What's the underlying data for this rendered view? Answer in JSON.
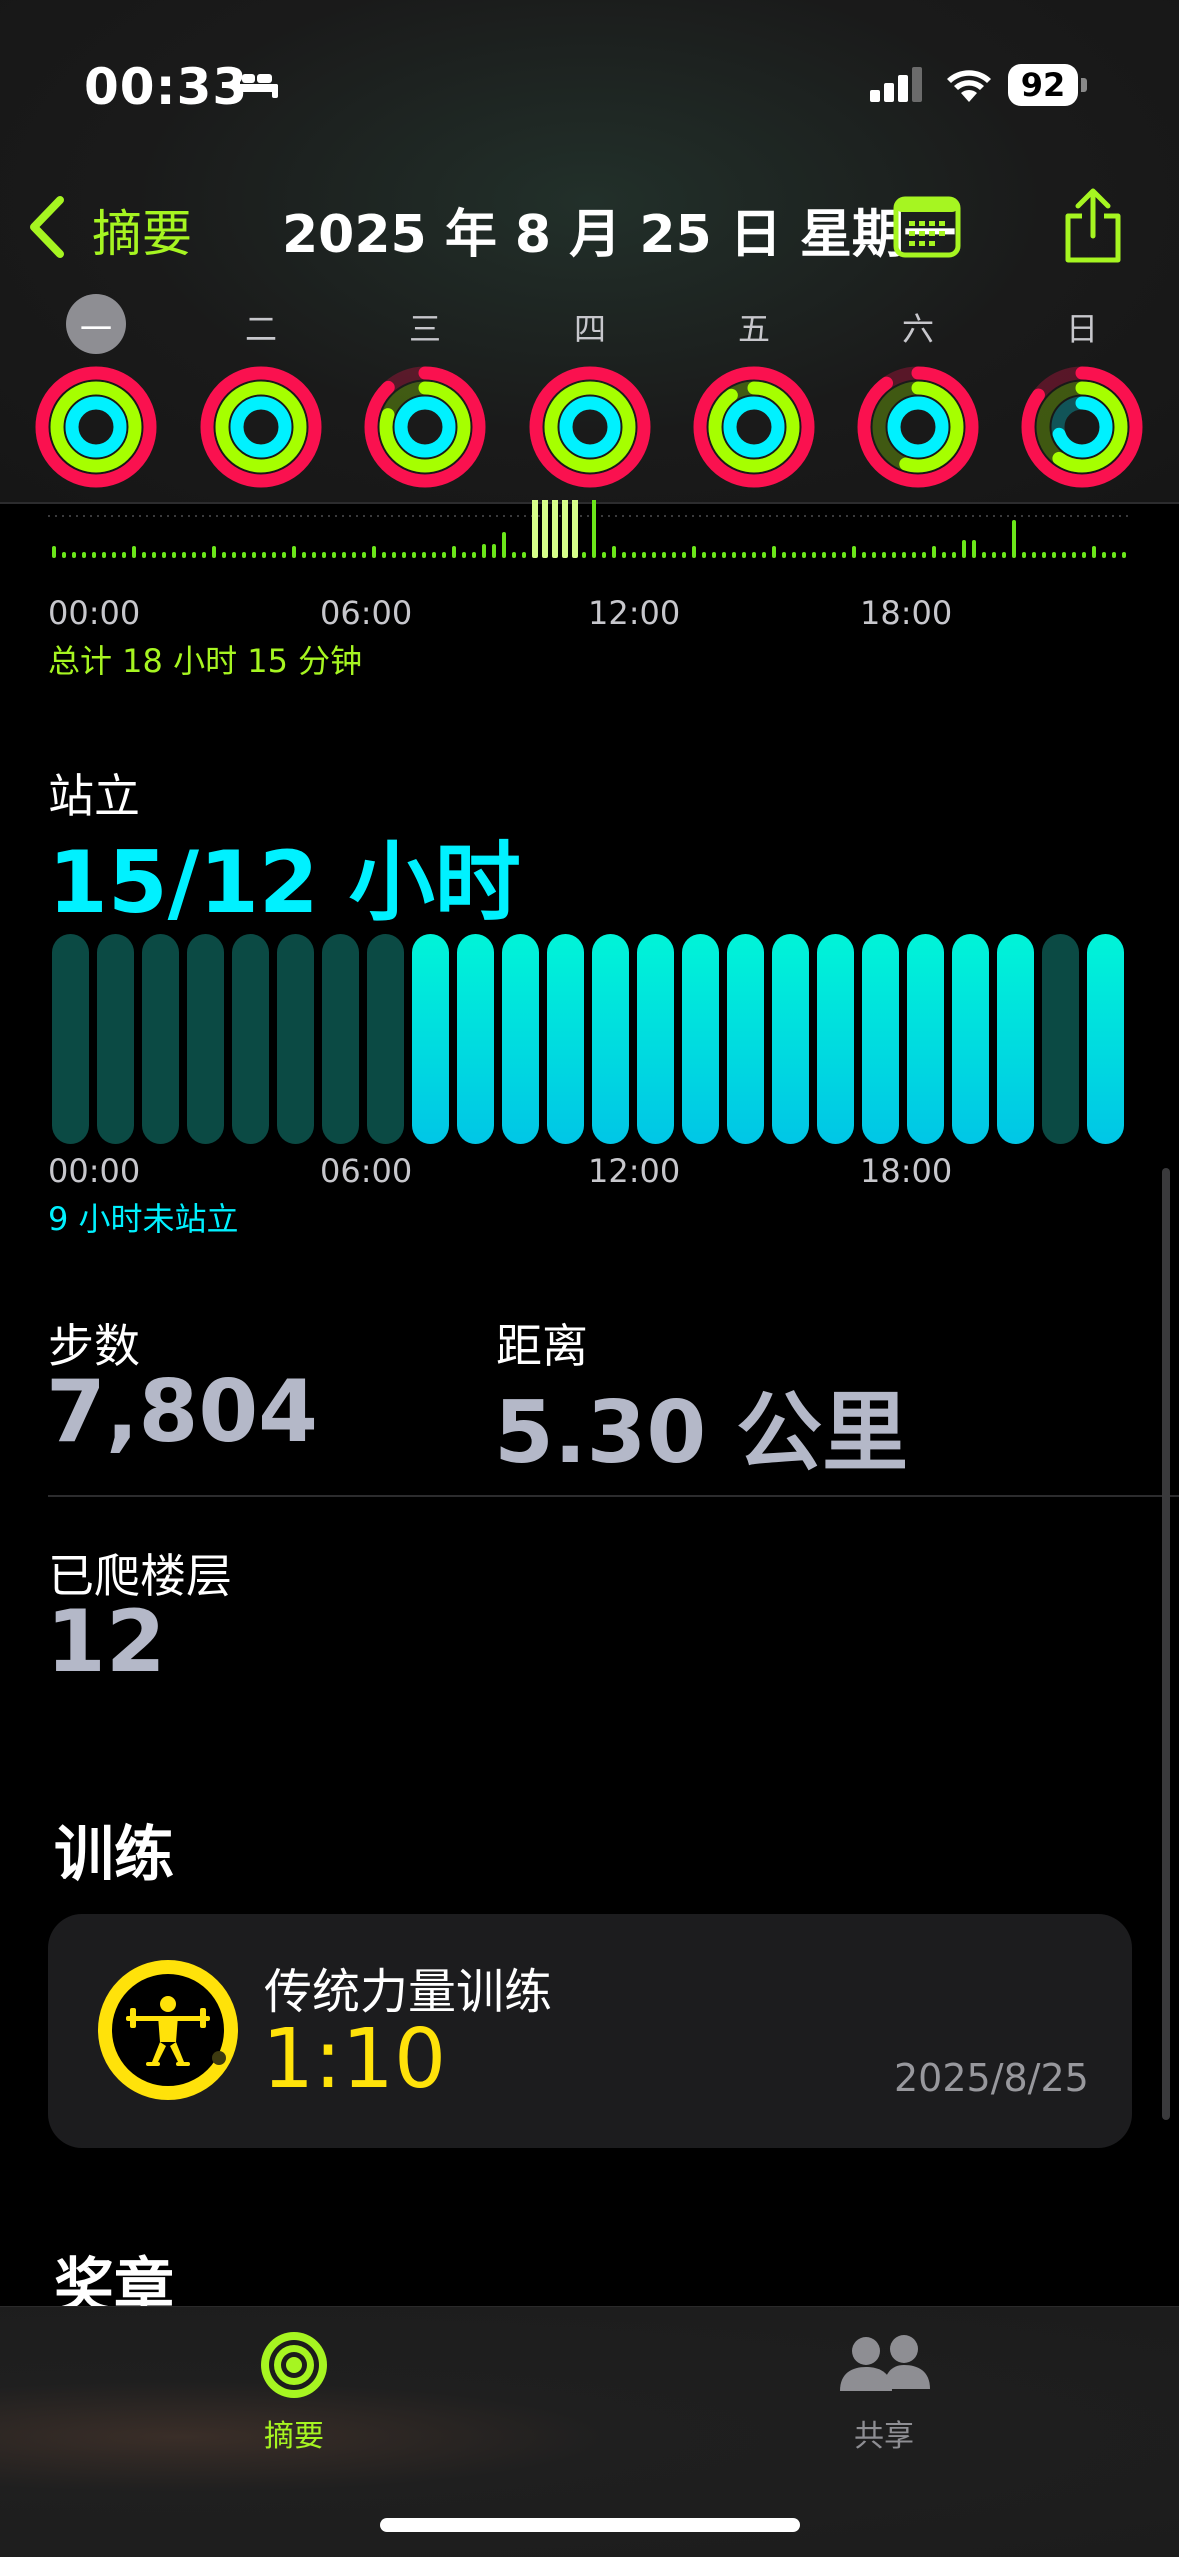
{
  "status_bar": {
    "time": "00:33",
    "battery": "92"
  },
  "nav": {
    "back_label": "摘要",
    "title": "2025 年 8 月 25 日 星期一"
  },
  "week": {
    "days": [
      "一",
      "二",
      "三",
      "四",
      "五",
      "六",
      "日"
    ],
    "selected_index": 0,
    "rings": [
      {
        "move": 1.0,
        "exercise": 1.0,
        "stand": 1.0
      },
      {
        "move": 1.0,
        "exercise": 1.0,
        "stand": 1.0
      },
      {
        "move": 0.88,
        "exercise": 0.8,
        "stand": 1.0
      },
      {
        "move": 1.0,
        "exercise": 1.0,
        "stand": 1.0
      },
      {
        "move": 1.0,
        "exercise": 0.9,
        "stand": 1.0
      },
      {
        "move": 0.9,
        "exercise": 0.55,
        "stand": 1.0
      },
      {
        "move": 0.85,
        "exercise": 0.6,
        "stand": 0.7
      }
    ]
  },
  "move_chart": {
    "ticks": [
      "00:00",
      "06:00",
      "12:00",
      "18:00"
    ],
    "total": "总计 18 小时 15 分钟"
  },
  "stand": {
    "label": "站立",
    "value": "15/12 小时",
    "hours": [
      0,
      0,
      0,
      0,
      0,
      0,
      0,
      0,
      1,
      1,
      1,
      1,
      1,
      1,
      1,
      1,
      1,
      1,
      1,
      1,
      1,
      1,
      0,
      1
    ],
    "ticks": [
      "00:00",
      "06:00",
      "12:00",
      "18:00"
    ],
    "note": "9 小时未站立"
  },
  "stats": {
    "steps_label": "步数",
    "steps_value": "7,804",
    "distance_label": "距离",
    "distance_value": "5.30 公里",
    "floors_label": "已爬楼层",
    "floors_value": "12"
  },
  "workouts": {
    "header": "训练",
    "items": [
      {
        "name": "传统力量训练",
        "duration": "1:10",
        "date": "2025/8/25"
      }
    ]
  },
  "awards_header": "奖章",
  "tabs": [
    {
      "label": "摘要",
      "active": true
    },
    {
      "label": "共享",
      "active": false
    }
  ],
  "colors": {
    "accent": "#a6f521",
    "move": "#fa114f",
    "exercise": "#a6ff00",
    "stand": "#00f1ff",
    "workout": "#ffe20a",
    "stand_inactive": "#0b4a44"
  }
}
